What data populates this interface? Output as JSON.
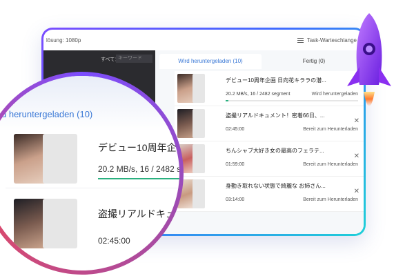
{
  "topbar": {
    "resolution_label": "lösung: 1080p",
    "queue_label": "Task-Warteschlange",
    "queue_icon": "list-icon"
  },
  "leftpane": {
    "all_label": "すべて：",
    "search_placeholder": "キーワード"
  },
  "tabs": [
    {
      "label": "Wird heruntergeladen (10)"
    },
    {
      "label": "Fertig (0)"
    }
  ],
  "downloads": [
    {
      "title": "デビュー10周年企画 日向花キララの潜...",
      "info": "20.2 MB/s, 16 / 2482 segment",
      "status": "Wird heruntergeladen",
      "progress": 0.01
    },
    {
      "title": "盗撮リアルドキュメント！密着66日、...",
      "info": "02:45:00",
      "status": "Bereit zum Herunterladen"
    },
    {
      "title": "ちんシャブ大好き女の最高のフェラテ...",
      "info": "01:59:00",
      "status": "Bereit zum Herunterladen"
    },
    {
      "title": "身動き取れない状態で綺麗な お姉さん...",
      "info": "03:14:00",
      "status": "Bereit zum Herunterladen"
    }
  ],
  "lens": {
    "tab_label": "d heruntergeladen (10)",
    "row1_title": "デビュー10周年企画",
    "row1_info": "20.2 MB/s, 16 / 2482 se",
    "row2_title": "盗撮リアルドキュ",
    "row2_info": "02:45:00"
  },
  "colors": {
    "accent": "#3a78d6",
    "progress": "#2ab07f",
    "frame_start": "#7b4dff",
    "frame_end": "#1fd0d8"
  }
}
